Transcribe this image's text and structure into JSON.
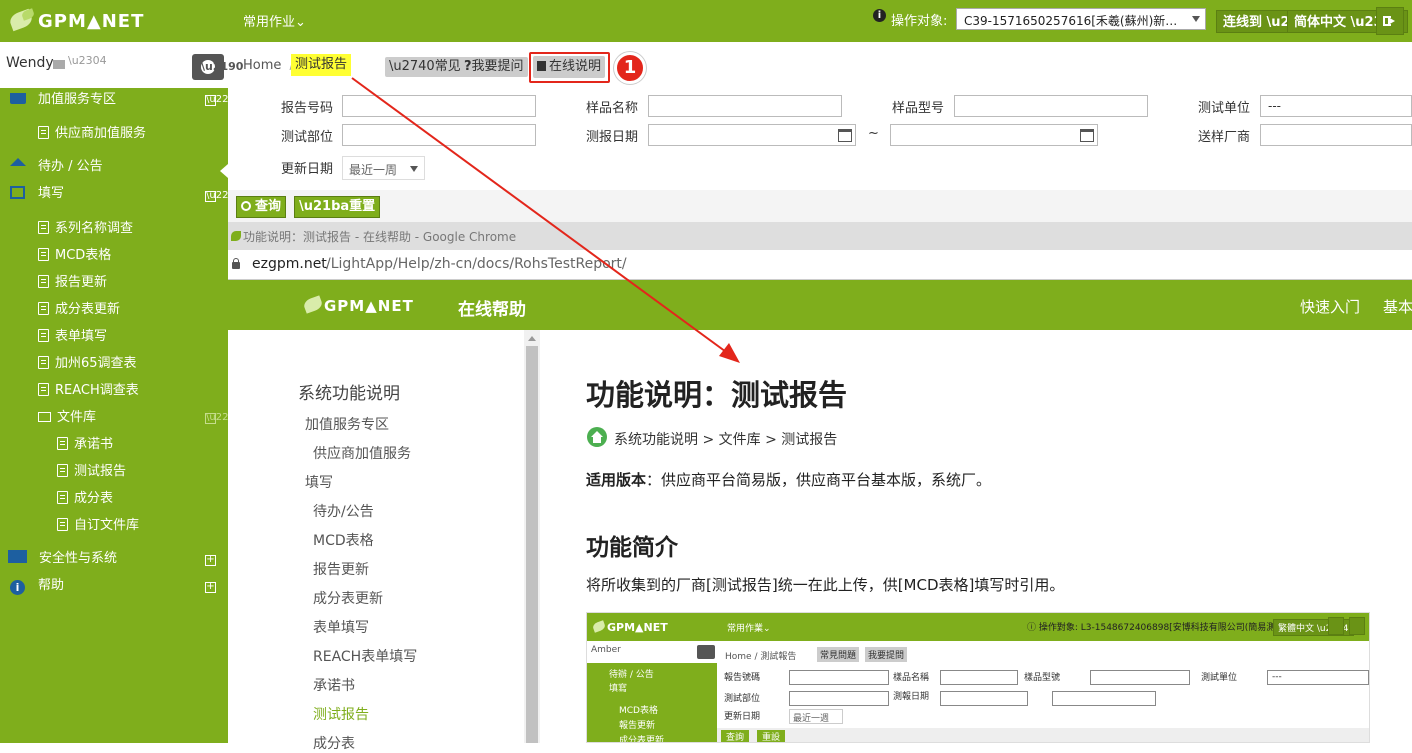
{
  "app": {
    "logo_text": "GPM▲NET",
    "menu_common": "常用作业⌄",
    "operation_target_label": "操作对象:",
    "operation_target_value": "C39-1571650257616[禾羲(蘇州)新…",
    "connect_button": "连线到",
    "language_button": "简体中文",
    "colors": {
      "brand": "#7fae1c",
      "brand_dark": "#6a9316",
      "highlight": "#ffff33",
      "arrow": "#e3261b"
    }
  },
  "sidebar": {
    "user": "Wendy",
    "items": [
      {
        "label": "加值服务专区",
        "icon": "cart-icon",
        "toggle": "⊟"
      },
      {
        "label": "供应商加值服务",
        "icon": "doc-icon"
      },
      {
        "label": "待办 / 公告",
        "icon": "home-icon"
      },
      {
        "label": "填写",
        "icon": "edit-icon",
        "toggle": "⊟"
      },
      {
        "label": "系列名称调查",
        "icon": "doc-icon"
      },
      {
        "label": "MCD表格",
        "icon": "doc-icon"
      },
      {
        "label": "报告更新",
        "icon": "doc-icon"
      },
      {
        "label": "成分表更新",
        "icon": "doc-icon"
      },
      {
        "label": "表单填写",
        "icon": "doc-icon"
      },
      {
        "label": "加州65调查表",
        "icon": "doc-icon"
      },
      {
        "label": "REACH调查表",
        "icon": "doc-icon"
      },
      {
        "label": "文件库",
        "icon": "folder-icon",
        "toggle": "⊟"
      },
      {
        "label": "承诺书",
        "icon": "doc-icon"
      },
      {
        "label": "测试报告",
        "icon": "doc-icon"
      },
      {
        "label": "成分表",
        "icon": "doc-icon"
      },
      {
        "label": "自订文件库",
        "icon": "doc-icon"
      },
      {
        "label": "安全性与系统",
        "icon": "monitor-icon",
        "toggle": "⊞"
      },
      {
        "label": "帮助",
        "icon": "info-icon",
        "toggle": "⊞"
      }
    ]
  },
  "breadcrumb": {
    "home": "Home",
    "sep": "/",
    "current": "测试报告"
  },
  "toolbar": {
    "faq": "常见问题",
    "ask": "我要提问",
    "online_help": "在线说明",
    "badge": "1"
  },
  "form": {
    "report_no": "报告号码",
    "sample_name": "样品名称",
    "sample_model": "样品型号",
    "test_unit": "测试单位",
    "test_unit_value": "---",
    "test_part": "测试部位",
    "report_date": "测报日期",
    "tilde": "~",
    "send_factory": "送样厂商",
    "update_date": "更新日期",
    "update_date_value": "最近一周",
    "query": "查询",
    "reset": "重置"
  },
  "chrome": {
    "window_title": "功能说明：测试报告 - 在线帮助 - Google Chrome",
    "url_host": "ezgpm.net",
    "url_path": "/LightApp/Help/zh-cn/docs/RohsTestReport/"
  },
  "help": {
    "logo_text": "GPM▲NET",
    "site_title": "在线帮助",
    "nav_quickstart": "快速入门",
    "nav_basic": "基本",
    "toc_title": "系统功能说明",
    "toc": [
      "加值服务专区",
      "供应商加值服务",
      "填写",
      "待办/公告",
      "MCD表格",
      "报告更新",
      "成分表更新",
      "表单填写",
      "REACH表单填写",
      "承诺书",
      "测试报告",
      "成分表"
    ],
    "page_title": "功能说明：测试报告",
    "crumbs": "系统功能说明 > 文件库 > 测试报告",
    "version_label": "适用版本",
    "version_text": "：供应商平台简易版，供应商平台基本版，系统厂。",
    "intro_heading": "功能简介",
    "intro_text": "将所收集到的厂商[测试报告]统一在此上传，供[MCD表格]填写时引用。"
  },
  "mini_screenshot": {
    "logo": "GPM▲NET",
    "menu": "常用作業⌄",
    "target": "ⓘ 操作對象: L3-1548672406898[安博科技有限公司(簡易測試)]",
    "lang": "繁體中文",
    "user": "Amber",
    "breadcrumb": "Home /  測試報告",
    "faq": "常見問題",
    "ask": "我要提問",
    "side1": "待辦 / 公告",
    "side2": "填寫",
    "side3": "MCD表格",
    "side4": "報告更新",
    "side5": "成分表更新",
    "f1": "報告號碼",
    "f2": "樣品名稱",
    "f3": "樣品型號",
    "f4": "測試單位",
    "f5": "測試部位",
    "f6": "測報日期",
    "f7": "更新日期",
    "f7v": "最近一週",
    "f4v": "---",
    "q": "查詢",
    "r": "重設"
  }
}
